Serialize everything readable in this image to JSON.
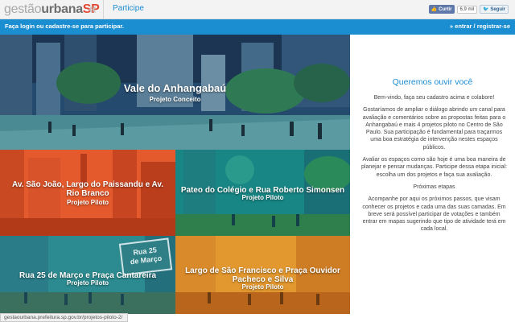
{
  "header": {
    "logo_part1": "gestão",
    "logo_part2": "urbana",
    "logo_part3": "SP",
    "nav_participe": "Participe",
    "like_label": "Curtir",
    "like_count": "6,9 mil",
    "follow_label": "Seguir"
  },
  "login_bar": {
    "message": "Faça login ou cadastre-se para participar.",
    "enter_label": "entrar",
    "separator": "/",
    "register_label": "registrar-se"
  },
  "projects": [
    {
      "title": "Vale do Anhangabaú",
      "subtitle": "Projeto Conceito"
    },
    {
      "title": "Av. São João, Largo do Paissandu e Av. Rio Branco",
      "subtitle": "Projeto Piloto"
    },
    {
      "title": "Pateo do Colégio e Rua Roberto Simonsen",
      "subtitle": "Projeto Piloto"
    },
    {
      "title": "Rua 25 de Março e Praça Cantareira",
      "subtitle": "Projeto Piloto"
    },
    {
      "title": "Largo de São Francisco e Praça Ouvidor Pacheco e Silva",
      "subtitle": "Projeto Piloto"
    }
  ],
  "signs": {
    "street_sign_line1": "Rua 25",
    "street_sign_line2": "de Março"
  },
  "panel": {
    "heading": "Queremos ouvir você",
    "p1": "Bem-vindo, faça seu cadastro acima e colabore!",
    "p2": "Gostaríamos de ampliar o diálogo abrindo um canal para avaliação e comentários sobre as propostas feitas para o Anhangabaú e mais 4 projetos piloto no Centro de São Paulo. Sua participação é fundamental para traçarmos uma boa estratégia de intervenção nestes espaços públicos.",
    "p3": "Avaliar os espaços como são hoje é uma boa maneira de planejar e pensar mudanças. Participe dessa etapa inicial: escolha um dos projetos e faça sua avaliação.",
    "p4": "Próximas etapas",
    "p5": "Acompanhe por aqui os próximos passos, que visam conhecer os projetos e cada uma das suas camadas. Em breve será possível participar de votações e também entrar em mapas sugerindo que tipo de atividade terá em cada local."
  },
  "status_url": "gestaourbana.prefeitura.sp.gov.br/projetos-piloto-2/",
  "colors": {
    "accent": "#1b8dd1",
    "logo_red": "#e34a33",
    "tile_red": "#e75b2f",
    "tile_teal": "#1a8b86",
    "tile_orange": "#e8a13a"
  }
}
